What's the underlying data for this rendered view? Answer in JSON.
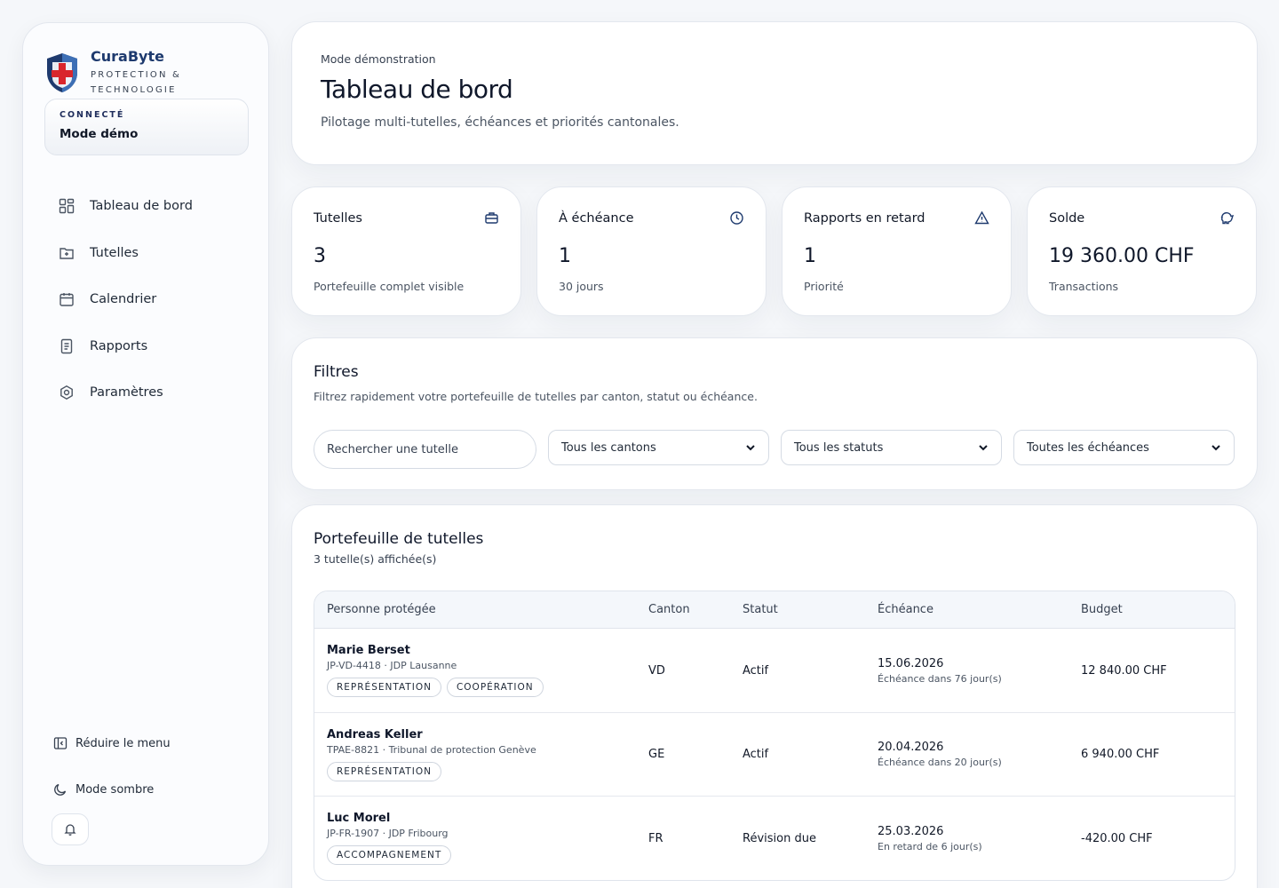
{
  "brand": {
    "name": "CuraByte",
    "tagline": "PROTECTION & TECHNOLOGIE"
  },
  "session": {
    "label": "CONNECTÉ",
    "value": "Mode démo"
  },
  "nav": [
    {
      "label": "Tableau de bord",
      "icon": "dashboard-icon"
    },
    {
      "label": "Tutelles",
      "icon": "folder-plus-icon"
    },
    {
      "label": "Calendrier",
      "icon": "calendar-icon"
    },
    {
      "label": "Rapports",
      "icon": "document-icon"
    },
    {
      "label": "Paramètres",
      "icon": "settings-icon"
    }
  ],
  "sidebar_bottom": {
    "collapse": "Réduire le menu",
    "dark_mode": "Mode sombre"
  },
  "hero": {
    "eyebrow": "Mode démonstration",
    "title": "Tableau de bord",
    "subtitle": "Pilotage multi-tutelles, échéances et priorités cantonales."
  },
  "stats": [
    {
      "label": "Tutelles",
      "value": "3",
      "foot": "Portefeuille complet visible",
      "icon": "briefcase-icon"
    },
    {
      "label": "À échéance",
      "value": "1",
      "foot": "30 jours",
      "icon": "clock-icon"
    },
    {
      "label": "Rapports en retard",
      "value": "1",
      "foot": "Priorité",
      "icon": "warning-icon"
    },
    {
      "label": "Solde",
      "value": "19 360.00 CHF",
      "foot": "Transactions",
      "icon": "piggy-bank-icon"
    }
  ],
  "filters": {
    "title": "Filtres",
    "subtitle": "Filtrez rapidement votre portefeuille de tutelles par canton, statut ou échéance.",
    "search_placeholder": "Rechercher une tutelle",
    "canton": "Tous les cantons",
    "status": "Tous les statuts",
    "due": "Toutes les échéances"
  },
  "portfolio": {
    "title": "Portefeuille de tutelles",
    "count": "3 tutelle(s) affichée(s)",
    "columns": [
      "Personne protégée",
      "Canton",
      "Statut",
      "Échéance",
      "Budget"
    ],
    "rows": [
      {
        "name": "Marie Berset",
        "ref": "JP-VD-4418 · JDP Lausanne",
        "tags": [
          "REPRÉSENTATION",
          "COOPÉRATION"
        ],
        "canton": "VD",
        "status": "Actif",
        "due": "15.06.2026",
        "due_note": "Échéance dans 76 jour(s)",
        "budget": "12 840.00 CHF"
      },
      {
        "name": "Andreas Keller",
        "ref": "TPAE-8821 · Tribunal de protection Genève",
        "tags": [
          "REPRÉSENTATION"
        ],
        "canton": "GE",
        "status": "Actif",
        "due": "20.04.2026",
        "due_note": "Échéance dans 20 jour(s)",
        "budget": "6 940.00 CHF"
      },
      {
        "name": "Luc Morel",
        "ref": "JP-FR-1907 · JDP Fribourg",
        "tags": [
          "ACCOMPAGNEMENT"
        ],
        "canton": "FR",
        "status": "Révision due",
        "due": "25.03.2026",
        "due_note": "En retard de 6 jour(s)",
        "budget": "-420.00 CHF"
      }
    ]
  },
  "colors": {
    "brand_blue": "#1e3a6e",
    "brand_red": "#d9262c"
  }
}
